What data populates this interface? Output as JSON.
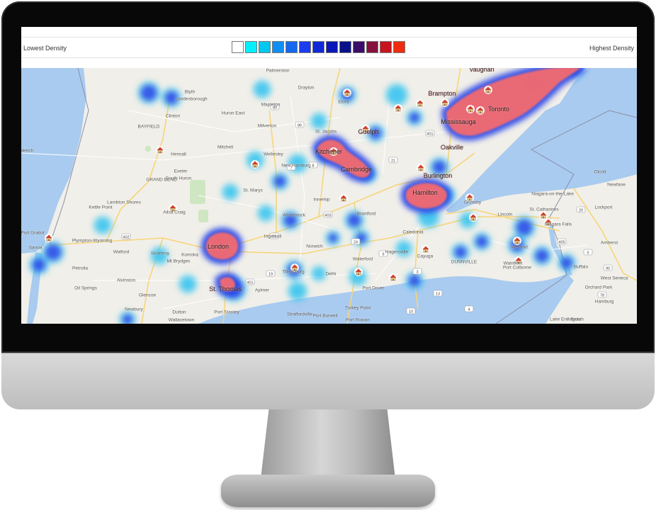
{
  "legend": {
    "low_label": "Lowest Density",
    "high_label": "Highest Density",
    "swatch_colors": [
      "#ffffff",
      "#00f0ff",
      "#00c8f0",
      "#0f8ef5",
      "#1468f0",
      "#1c3cf0",
      "#1028d8",
      "#0a18b8",
      "#08108a",
      "#3c0c6a",
      "#84123c",
      "#c8141e",
      "#f02c10"
    ]
  },
  "colors": {
    "water": "#a9cbef",
    "land": "#f1efe9",
    "heat_hot": "#f26a6f",
    "heat_blue": "#2a46e8",
    "heat_cyan": "#3cc6f0"
  },
  "icons": {
    "marker": "house-marker-icon"
  },
  "map": {
    "cities": [
      {
        "name": "Toronto"
      },
      {
        "name": "Mississauga"
      },
      {
        "name": "Hamilton"
      },
      {
        "name": "London"
      },
      {
        "name": "Kitchener"
      },
      {
        "name": "Cambridge"
      },
      {
        "name": "Brampton"
      },
      {
        "name": "Oakville"
      },
      {
        "name": "Vaughan"
      },
      {
        "name": "Burlington"
      },
      {
        "name": "Guelph"
      },
      {
        "name": "St. Thomas"
      }
    ],
    "places": [
      {
        "name": "Palmerston"
      },
      {
        "name": "Blyth"
      },
      {
        "name": "Londesborough"
      },
      {
        "name": "Drayton"
      },
      {
        "name": "Elora"
      },
      {
        "name": "Clinton"
      },
      {
        "name": "Huron East"
      },
      {
        "name": "Mapleton"
      },
      {
        "name": "BAYFIELD"
      },
      {
        "name": "Milverton"
      },
      {
        "name": "St. Jacobs"
      },
      {
        "name": "Mitchell"
      },
      {
        "name": "Hensall"
      },
      {
        "name": "Wellesley"
      },
      {
        "name": "New Hamburg"
      },
      {
        "name": "Exeter"
      },
      {
        "name": "South Huron"
      },
      {
        "name": "GRAND BEND"
      },
      {
        "name": "St. Marys"
      },
      {
        "name": "Lambton Shores"
      },
      {
        "name": "Innerkip"
      },
      {
        "name": "Kettle Point"
      },
      {
        "name": "Ailsa Craig"
      },
      {
        "name": "Woodstock"
      },
      {
        "name": "Brantford"
      },
      {
        "name": "Port Gratiot"
      },
      {
        "name": "Plympton-Wyoming"
      },
      {
        "name": "Ingersoll"
      },
      {
        "name": "Watford"
      },
      {
        "name": "Strathroy"
      },
      {
        "name": "Komoka"
      },
      {
        "name": "Norwich"
      },
      {
        "name": "Waterford"
      },
      {
        "name": "Hagersville"
      },
      {
        "name": "Caledonia"
      },
      {
        "name": "Cayuga"
      },
      {
        "name": "Petrolia"
      },
      {
        "name": "Mt Brydges"
      },
      {
        "name": "Oil Springs"
      },
      {
        "name": "Alvinston"
      },
      {
        "name": "Glencoe"
      },
      {
        "name": "Aylmer"
      },
      {
        "name": "Delhi"
      },
      {
        "name": "Tillsonburg"
      },
      {
        "name": "Port Dover"
      },
      {
        "name": "Newbury"
      },
      {
        "name": "Dutton"
      },
      {
        "name": "Wallacetown"
      },
      {
        "name": "Port Stanley"
      },
      {
        "name": "Port Burwell"
      },
      {
        "name": "Port Rowan"
      },
      {
        "name": "Turkey Point"
      },
      {
        "name": "Straffordville"
      },
      {
        "name": "Grimsby"
      },
      {
        "name": "Lincoln"
      },
      {
        "name": "St. Catharines"
      },
      {
        "name": "Niagara Falls"
      },
      {
        "name": "Welland"
      },
      {
        "name": "Wainfleet"
      },
      {
        "name": "Port Colborne"
      },
      {
        "name": "Buffalo"
      },
      {
        "name": "West Seneca"
      },
      {
        "name": "Niagara-on-the-Lake"
      },
      {
        "name": "Olcott"
      },
      {
        "name": "Newfane"
      },
      {
        "name": "Lockport"
      },
      {
        "name": "Amherst"
      },
      {
        "name": "Hamburg"
      },
      {
        "name": "Lake Erie Beach"
      },
      {
        "name": "Angola"
      },
      {
        "name": "Orchard Park"
      },
      {
        "name": "DUNNVILLE"
      },
      {
        "name": "Sarnia"
      },
      {
        "name": "Goderich"
      }
    ],
    "highway_shields": [
      "89",
      "86",
      "7",
      "8",
      "401",
      "403",
      "402",
      "401",
      "24",
      "6",
      "59",
      "19",
      "3",
      "4",
      "10",
      "13",
      "21",
      "405",
      "90",
      "78",
      "5",
      "20"
    ]
  }
}
